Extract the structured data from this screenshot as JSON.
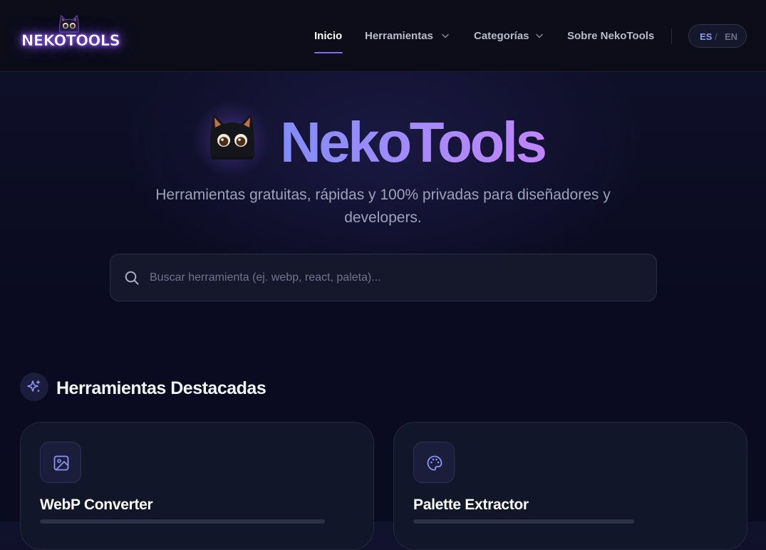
{
  "header": {
    "logo_text": "NEKOTOOLS",
    "nav": [
      {
        "label": "Inicio",
        "active": true
      },
      {
        "label": "Herramientas",
        "has_dropdown": true
      },
      {
        "label": "Categorías",
        "has_dropdown": true
      },
      {
        "label": "Sobre NekoTools"
      }
    ],
    "lang": {
      "active": "ES",
      "separator": "/",
      "other": "EN"
    }
  },
  "hero": {
    "title": "NekoTools",
    "subtitle": "Herramientas gratuitas, rápidas y 100% privadas para diseñadores y developers.",
    "search_placeholder": "Buscar herramienta (ej. webp, react, paleta)...",
    "search_value": ""
  },
  "featured": {
    "title": "Herramientas Destacadas",
    "icon": "sparkles-icon",
    "cards": [
      {
        "title": "WebP Converter",
        "icon": "image-icon"
      },
      {
        "title": "Palette Extractor",
        "icon": "palette-icon"
      }
    ]
  },
  "colors": {
    "accent": "#7c6cf2",
    "title_gradient_start": "#818cf8",
    "title_gradient_end": "#c084fc",
    "background": "#0a0b20",
    "header_bg": "#0c0d19"
  }
}
